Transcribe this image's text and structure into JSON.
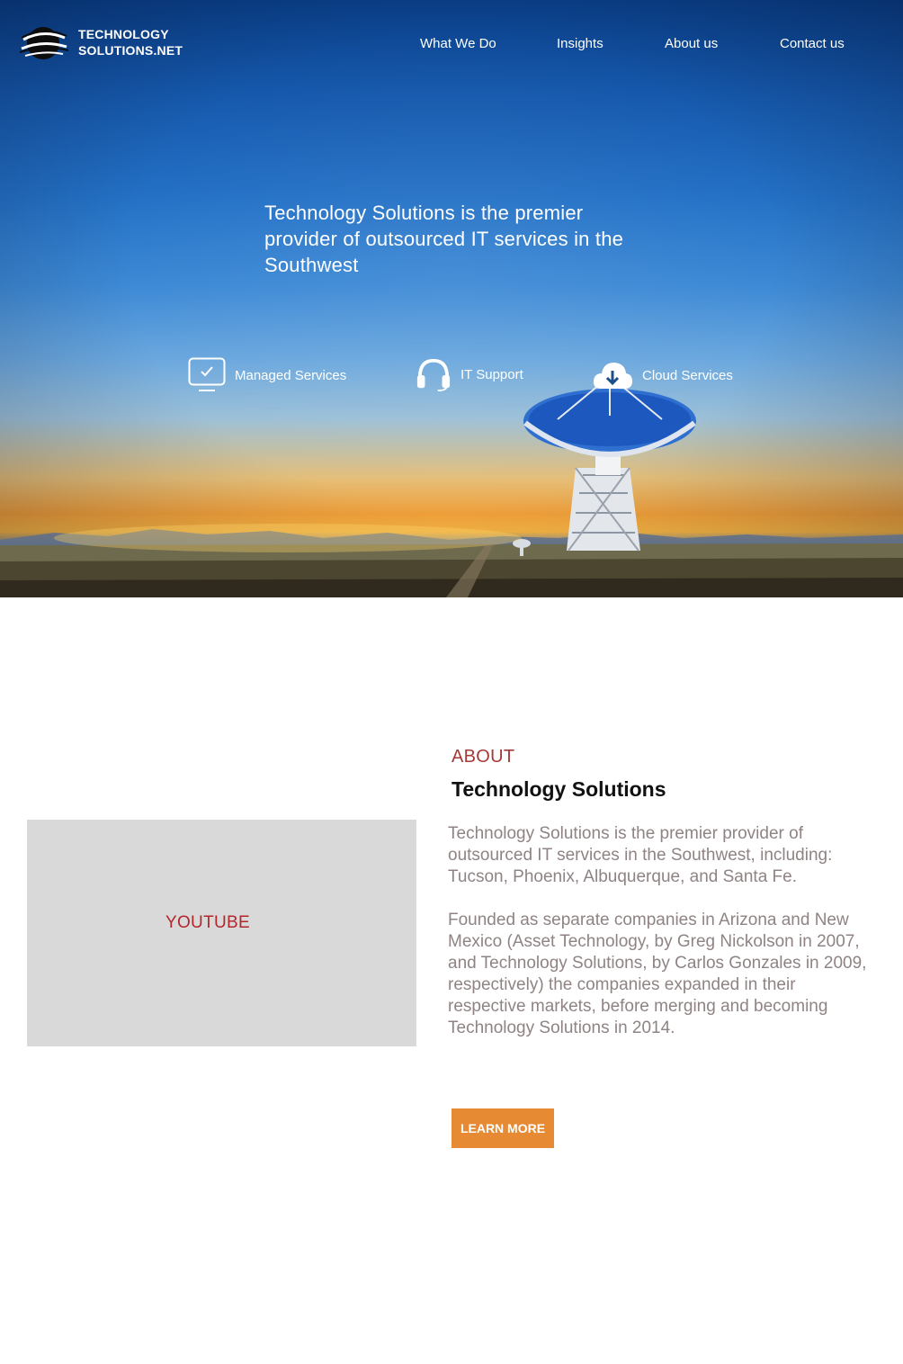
{
  "brand": {
    "name_line1": "TECHNOLOGY",
    "name_line2": "SOLUTIONS.NET"
  },
  "nav": {
    "items": [
      "What We Do",
      "Insights",
      "About us",
      "Contact us"
    ]
  },
  "hero": {
    "headline": "Technology Solutions is the premier\n provider of outsourced IT services in the\n Southwest",
    "services": [
      {
        "label": "Managed Services",
        "icon": "monitor-check-icon"
      },
      {
        "label": "IT Support",
        "icon": "headset-icon"
      },
      {
        "label": "Cloud Services",
        "icon": "cloud-download-icon"
      }
    ]
  },
  "about": {
    "kicker": "ABOUT",
    "title": "Technology Solutions",
    "paragraph1": "Technology Solutions is the premier provider of outsourced IT services in the Southwest, including: Tucson, Phoenix, Albuquerque, and Santa Fe.",
    "paragraph2": "Founded as separate companies in Arizona and New Mexico (Asset Technology, by Greg Nickolson in 2007, and Technology Solutions, by Carlos Gonzales in 2009, respectively) the companies expanded in their respective markets, before merging and becoming Technology Solutions in 2014.",
    "button_label": "LEARN MORE"
  },
  "video": {
    "label": "YOUTUBE"
  },
  "colors": {
    "accent_orange": "#e68a34",
    "kicker_red": "#a33a36",
    "body_gray": "#8f8383",
    "video_placeholder": "#d9d9d9"
  }
}
